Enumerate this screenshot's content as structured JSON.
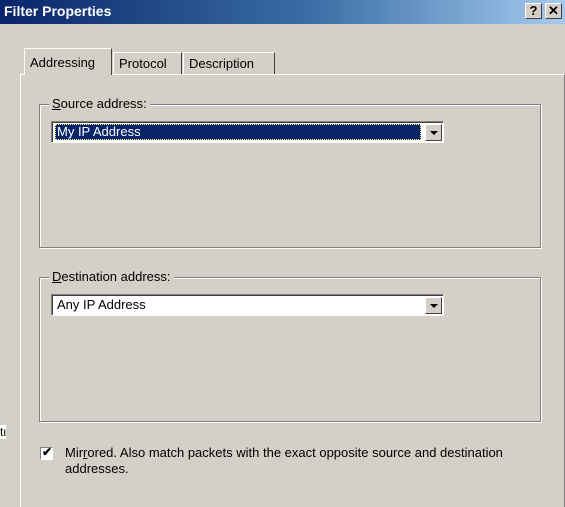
{
  "window": {
    "title": "Filter Properties",
    "help_glyph": "?",
    "close_glyph": "✕"
  },
  "tabs": [
    {
      "label": "Addressing",
      "active": true
    },
    {
      "label": "Protocol",
      "active": false
    },
    {
      "label": "Description",
      "active": false
    }
  ],
  "source": {
    "label_accel": "S",
    "label_rest": "ource address:",
    "selected": "My IP Address"
  },
  "destination": {
    "label_accel": "D",
    "label_rest": "estination address:",
    "selected": "Any IP Address"
  },
  "mirrored": {
    "checked": true,
    "label_pre": "Mir",
    "label_accel": "r",
    "label_post": "ored. Also match packets with the exact opposite source and destination addresses."
  },
  "background_fragment": "tι",
  "icons": {
    "dropdown": "chevron-down-icon",
    "help": "help-icon",
    "close": "close-icon",
    "check": "checkmark-icon"
  },
  "colors": {
    "titlebar_start": "#0a246a",
    "titlebar_end": "#a6caf0",
    "dialog_face": "#d4d0c8",
    "selection": "#0a246a"
  }
}
